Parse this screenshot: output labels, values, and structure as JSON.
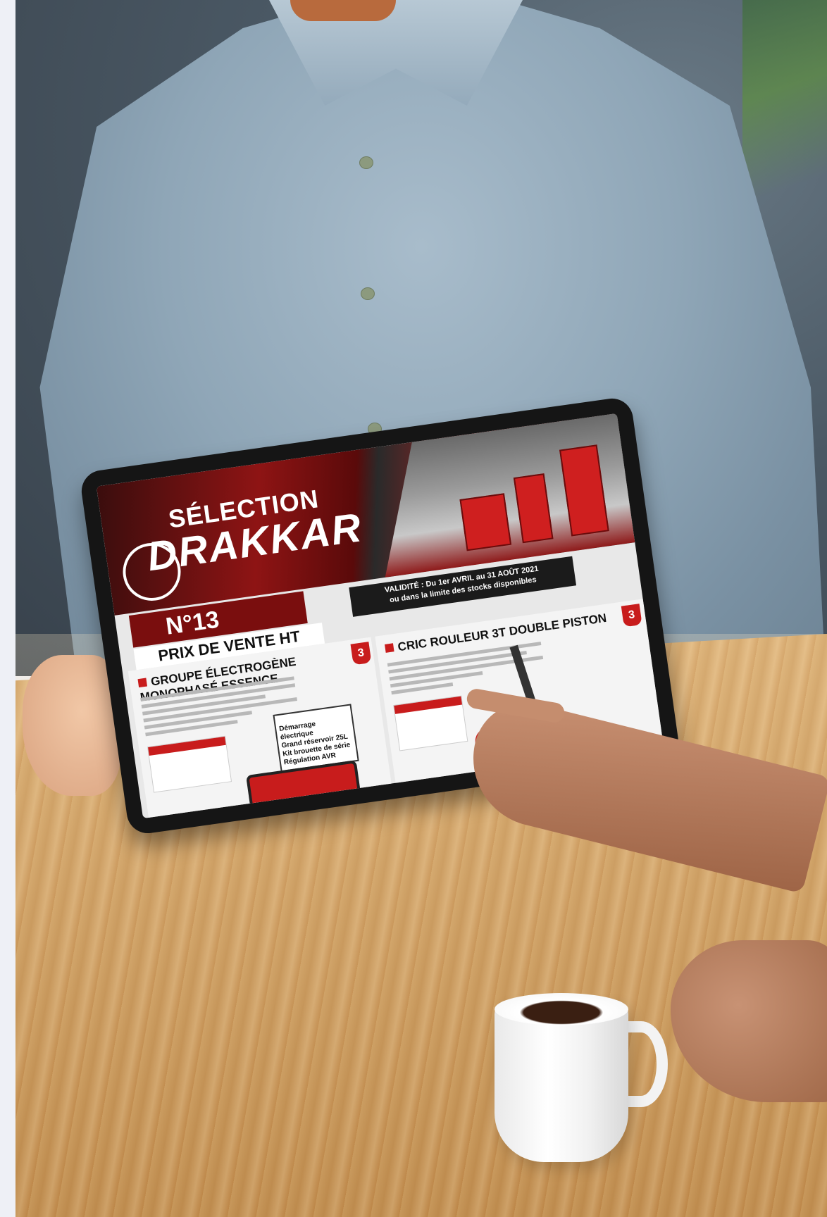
{
  "tablet": {
    "banner": {
      "title": "SÉLECTION",
      "brand": "DRAKKAR",
      "issue": "N°13",
      "validity_line1": "VALIDITÉ : Du 1er AVRIL au 31 AOÛT 2021",
      "validity_line2": "ou dans la limite des stocks disponibles"
    },
    "price_label": "PRIX DE VENTE HT",
    "left_panel": {
      "title": "GROUPE ÉLECTROGÈNE MONOPHASÉ ESSENCE",
      "badge": "3",
      "features": [
        "Démarrage électrique",
        "Grand réservoir 25L",
        "Kit brouette de série",
        "Régulation AVR"
      ]
    },
    "right_panel": {
      "title": "CRIC ROULEUR 3T DOUBLE PISTON",
      "badge": "3"
    }
  },
  "colors": {
    "brand_red": "#c81c1c",
    "shirt": "#8fa6b7",
    "table_wood": "#d4a565"
  }
}
